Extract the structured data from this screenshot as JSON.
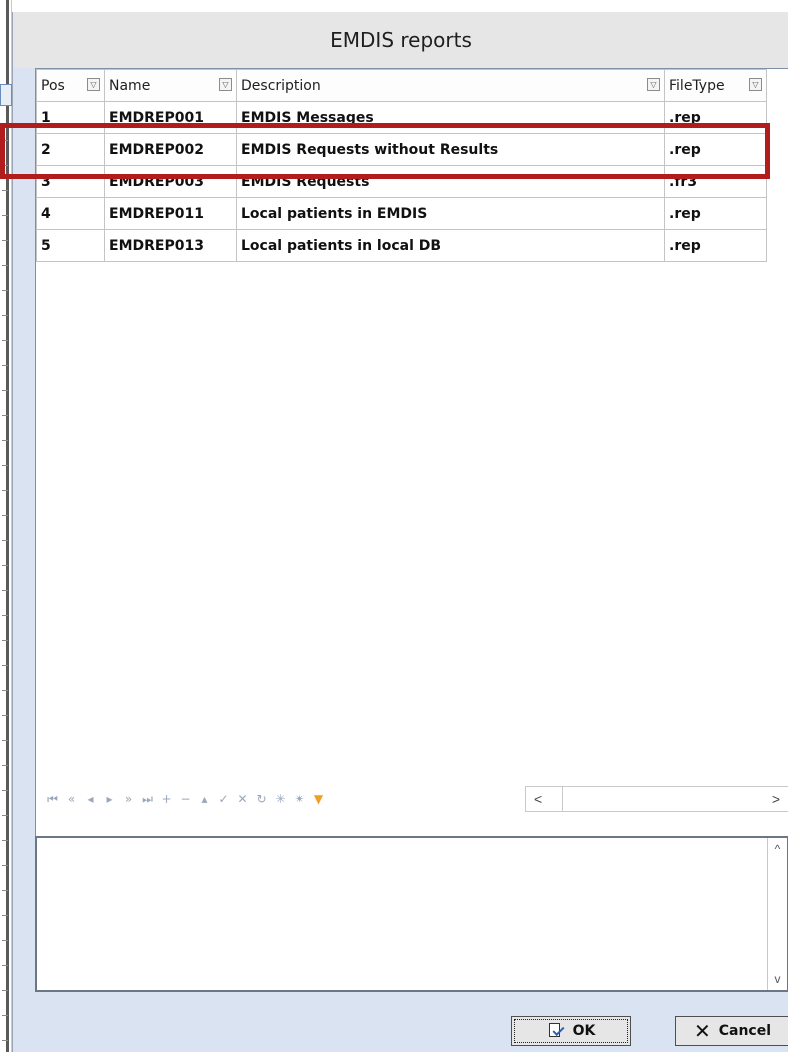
{
  "dialog": {
    "title": "EMDIS reports"
  },
  "grid": {
    "columns": [
      {
        "label": "Pos"
      },
      {
        "label": "Name"
      },
      {
        "label": "Description"
      },
      {
        "label": "FileType"
      }
    ],
    "rows": [
      {
        "pos": "1",
        "name": "EMDREP001",
        "description": "EMDIS Messages",
        "filetype": ".rep"
      },
      {
        "pos": "2",
        "name": "EMDREP002",
        "description": "EMDIS Requests without Results",
        "filetype": ".rep"
      },
      {
        "pos": "3",
        "name": "EMDREP003",
        "description": "EMDIS Requests",
        "filetype": ".fr3"
      },
      {
        "pos": "4",
        "name": "EMDREP011",
        "description": "Local patients in EMDIS",
        "filetype": ".rep"
      },
      {
        "pos": "5",
        "name": "EMDREP013",
        "description": "Local patients in local DB",
        "filetype": ".rep"
      }
    ],
    "highlighted_row": 2
  },
  "navigator": {
    "buttons": [
      "first-icon",
      "prev-page-icon",
      "prev-icon",
      "next-icon",
      "next-page-icon",
      "last-icon",
      "insert-icon",
      "delete-icon",
      "edit-icon",
      "post-icon",
      "cancel-icon",
      "refresh-icon",
      "save-bookmark-icon",
      "goto-bookmark-icon",
      "filter-icon"
    ],
    "scroll_left": "<",
    "scroll_right": ">"
  },
  "memo": {
    "scroll_up": "^",
    "scroll_down": "v"
  },
  "footer": {
    "ok_label": "OK",
    "cancel_label": "Cancel"
  },
  "colors": {
    "highlight_border": "#b11d1d",
    "dialog_bg": "#dae3f1",
    "filter_icon": "#f0a020"
  }
}
